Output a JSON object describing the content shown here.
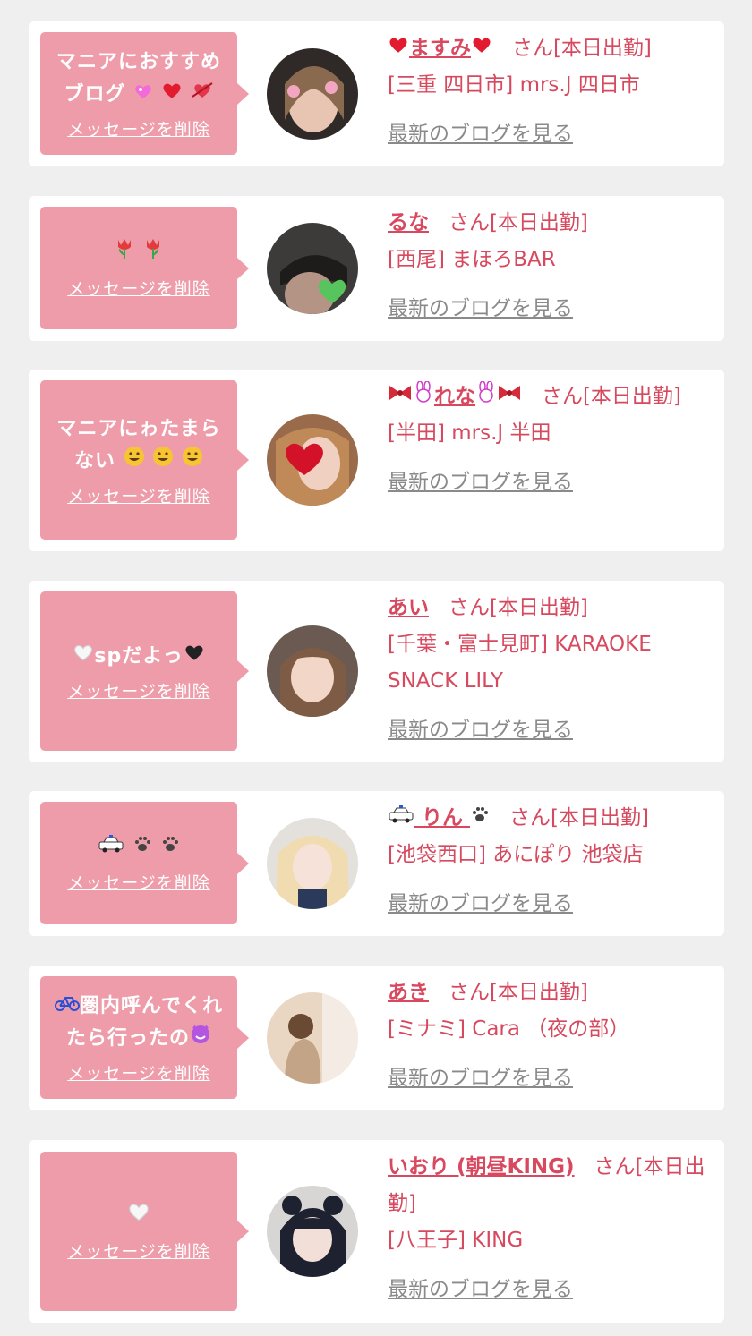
{
  "colors": {
    "page_bg": "#efefef",
    "card_bg": "#ffffff",
    "bubble_bg": "#ee9ca9",
    "accent": "#d8485e",
    "link_gray": "#8a8a8a"
  },
  "common": {
    "delete_label": "メッセージを削除",
    "blog_label": "最新のブログを見る",
    "suffix": "さん[本日出勤]"
  },
  "cards": [
    {
      "message": "マニアにおすすめブログ",
      "message_icons": [
        "sparkle-heart-icon",
        "red-heart-icon",
        "heart-arrow-icon"
      ],
      "name": "ますみ",
      "name_icons": [
        "red-heart-icon",
        "red-heart-icon"
      ],
      "shop": "[三重 四日市] mrs.J 四日市"
    },
    {
      "message": "",
      "message_icons": [
        "tulip-icon",
        "tulip-icon"
      ],
      "name": "るな",
      "name_icons": [],
      "shop": "[西尾] まほろBAR"
    },
    {
      "message": "マニアにゎたまらない",
      "message_icons": [
        "smile-icon",
        "smile-icon",
        "smile-icon"
      ],
      "name": "れな",
      "name_icons": [
        "ribbon-icon",
        "rabbit-icon",
        "rabbit-icon",
        "ribbon-icon"
      ],
      "shop": "[半田] mrs.J 半田"
    },
    {
      "message": "spだよっ",
      "message_icons": [
        "white-heart-icon",
        "black-heart-icon"
      ],
      "name": "あい",
      "name_icons": [],
      "shop": "[千葉・富士見町] KARAOKE SNACK LILY"
    },
    {
      "message": "",
      "message_icons": [
        "police-car-icon",
        "paw-icon",
        "paw-icon"
      ],
      "name": "りん",
      "name_icons": [
        "police-car-icon",
        "paw-icon"
      ],
      "shop": "[池袋西口] あにぽり 池袋店"
    },
    {
      "message": "圏内呼んでくれたら行ったの",
      "message_icons": [
        "bicycle-icon",
        "smiling-devil-icon"
      ],
      "name": "あき",
      "name_icons": [],
      "shop": "[ミナミ] Cara （夜の部）"
    },
    {
      "message": "",
      "message_icons": [
        "white-heart-icon"
      ],
      "name": "いおり (朝昼KING)",
      "name_icons": [],
      "shop": "[八王子] KING"
    }
  ]
}
